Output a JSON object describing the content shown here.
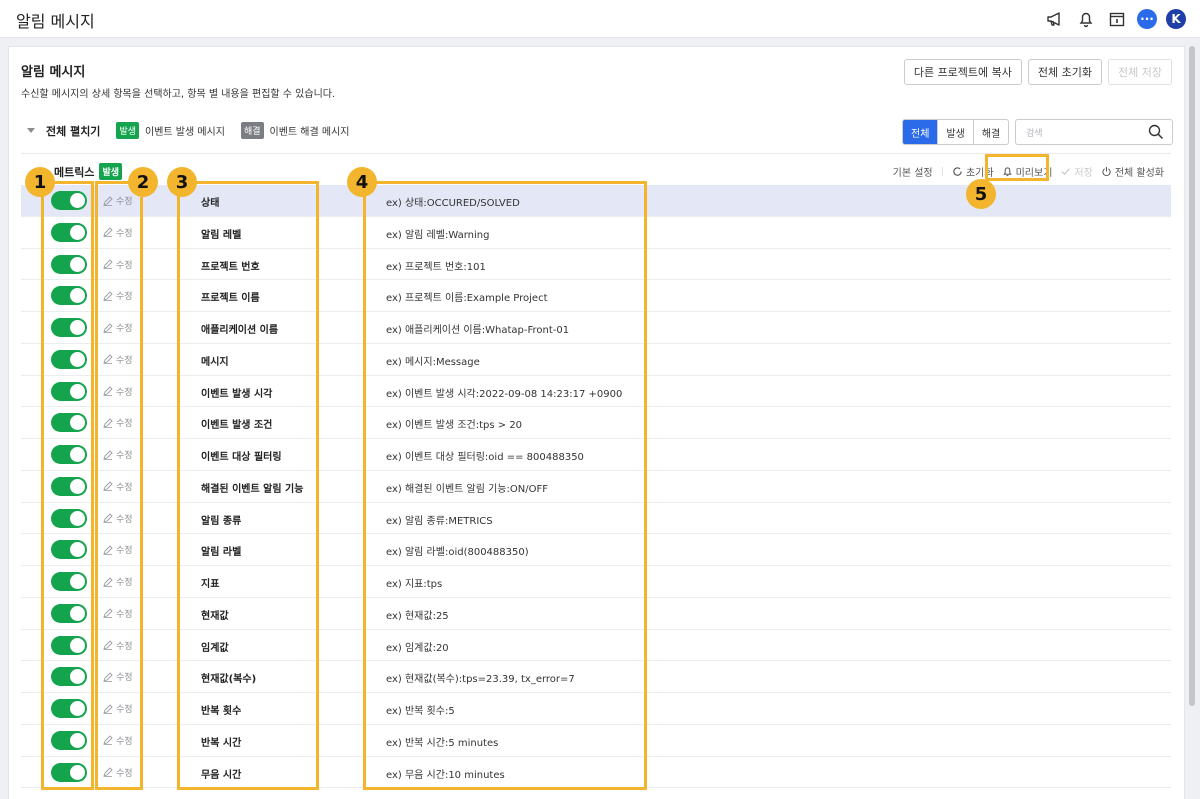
{
  "topbar": {
    "title": "알림 메시지",
    "avatar_initial": "K",
    "icons": [
      "megaphone-icon",
      "bell-icon",
      "calendar-icon",
      "chat-icon"
    ]
  },
  "header": {
    "title": "알림 메시지",
    "description": "수신할 메시지의 상세 항목을 선택하고, 항목 별 내용을 편집할 수 있습니다.",
    "buttons": {
      "copy": "다른 프로젝트에 복사",
      "reset_all": "전체 초기화",
      "save_all": "전체 저장"
    }
  },
  "controls": {
    "expand_all": "전체 펼치기",
    "badge_occur": "발생",
    "legend_occur": "이벤트 발생 메시지",
    "badge_solve": "해결",
    "legend_solve": "이벤트 해결 메시지",
    "filter_tabs": [
      "전체",
      "발생",
      "해결"
    ],
    "active_tab": "전체",
    "search_placeholder": "검색"
  },
  "section": {
    "title": "메트릭스",
    "badge": "발생",
    "actions": {
      "default_settings": "기본 설정",
      "reset": "초기화",
      "preview": "미리보기",
      "save": "저장",
      "activate_all": "전체 활성화"
    },
    "edit_label": "수정",
    "rows": [
      {
        "name": "상태",
        "example": "ex) 상태:OCCURED/SOLVED",
        "enabled": true
      },
      {
        "name": "알림 레벨",
        "example": "ex) 알림 레벨:Warning",
        "enabled": true
      },
      {
        "name": "프로젝트 번호",
        "example": "ex) 프로젝트 번호:101",
        "enabled": true
      },
      {
        "name": "프로젝트 이름",
        "example": "ex) 프로젝트 이름:Example Project",
        "enabled": true
      },
      {
        "name": "애플리케이션 이름",
        "example": "ex) 애플리케이션 이름:Whatap-Front-01",
        "enabled": true
      },
      {
        "name": "메시지",
        "example": "ex) 메시지:Message",
        "enabled": true
      },
      {
        "name": "이벤트 발생 시각",
        "example": "ex) 이벤트 발생 시각:2022-09-08 14:23:17 +0900",
        "enabled": true
      },
      {
        "name": "이벤트 발생 조건",
        "example": "ex) 이벤트 발생 조건:tps > 20",
        "enabled": true
      },
      {
        "name": "이벤트 대상 필터링",
        "example": "ex) 이벤트 대상 필터링:oid == 800488350",
        "enabled": true
      },
      {
        "name": "해결된 이벤트 알림 기능",
        "example": "ex) 해결된 이벤트 알림 기능:ON/OFF",
        "enabled": true
      },
      {
        "name": "알림 종류",
        "example": "ex) 알림 종류:METRICS",
        "enabled": true
      },
      {
        "name": "알림 라벨",
        "example": "ex) 알림 라벨:oid(800488350)",
        "enabled": true
      },
      {
        "name": "지표",
        "example": "ex) 지표:tps",
        "enabled": true
      },
      {
        "name": "현재값",
        "example": "ex) 현재값:25",
        "enabled": true
      },
      {
        "name": "임계값",
        "example": "ex) 임계값:20",
        "enabled": true
      },
      {
        "name": "현재값(복수)",
        "example": "ex) 현재값(복수):tps=23.39, tx_error=7",
        "enabled": true
      },
      {
        "name": "반복 횟수",
        "example": "ex) 반복 횟수:5",
        "enabled": true
      },
      {
        "name": "반복 시간",
        "example": "ex) 반복 시간:5 minutes",
        "enabled": true
      },
      {
        "name": "무음 시간",
        "example": "ex) 무음 시간:10 minutes",
        "enabled": true
      }
    ]
  },
  "annotations": {
    "labels": [
      "1",
      "2",
      "3",
      "4",
      "5"
    ],
    "color": "#f3b52e"
  },
  "colors": {
    "accent": "#2b6bea",
    "toggle_on": "#14a44d",
    "selected_row": "#e3e7f6"
  }
}
